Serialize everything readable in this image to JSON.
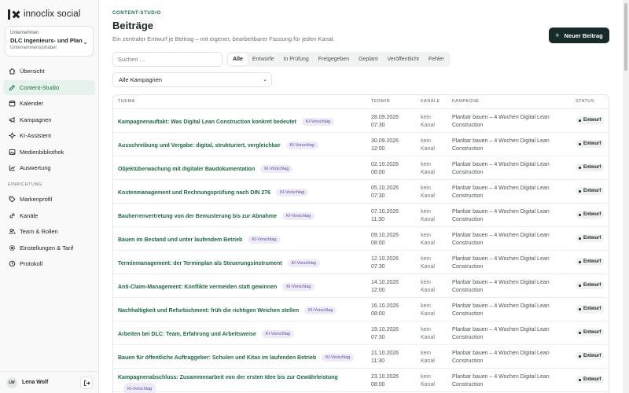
{
  "app": {
    "logo_text": "innoclix social"
  },
  "company": {
    "label": "Unternehmen",
    "name": "DLC Ingenieurs- und Planu",
    "role": "Unternehmensinhaber"
  },
  "nav": {
    "main": [
      {
        "label": "Übersicht",
        "icon": "home-icon"
      },
      {
        "label": "Content-Studio",
        "icon": "pen-icon",
        "active": true
      },
      {
        "label": "Kalender",
        "icon": "calendar-icon"
      },
      {
        "label": "Kampagnen",
        "icon": "megaphone-icon"
      },
      {
        "label": "KI-Assistent",
        "icon": "sparkle-icon"
      },
      {
        "label": "Medienbibliothek",
        "icon": "image-icon"
      },
      {
        "label": "Auswertung",
        "icon": "chart-icon"
      }
    ],
    "section_label": "EINRICHTUNG",
    "settings": [
      {
        "label": "Markenprofil",
        "icon": "tag-icon"
      },
      {
        "label": "Kanäle",
        "icon": "link-icon"
      },
      {
        "label": "Team & Rollen",
        "icon": "users-icon"
      },
      {
        "label": "Einstellungen & Tarif",
        "icon": "gear-icon"
      },
      {
        "label": "Protokoll",
        "icon": "clock-icon"
      }
    ]
  },
  "user": {
    "initials": "LW",
    "name": "Lena Wolf"
  },
  "header": {
    "eyebrow": "CONTENT-STUDIO",
    "title": "Beiträge",
    "subtitle": "Ein zentraler Entwurf je Beitrag – mit eigener, bearbeitbarer Fassung für jeden Kanal.",
    "new_button": "Neuer Beitrag"
  },
  "filters": {
    "search_placeholder": "Suchen …",
    "tabs": [
      "Alle",
      "Entwürfe",
      "In Prüfung",
      "Freigegeben",
      "Geplant",
      "Veröffentlicht",
      "Fehler"
    ],
    "active_tab": "Alle",
    "campaign_select": "Alle Kampagnen"
  },
  "table": {
    "headers": {
      "topic": "THEMA",
      "term": "TERMIN",
      "channel": "KANÄLE",
      "campaign": "KAMPAGNE",
      "status": "STATUS"
    },
    "ki_badge": "KI-Vorschlag",
    "rows": [
      {
        "topic": "Kampagnenauftakt: Was Digital Lean Construction konkret bedeutet",
        "date": "28.09.2026",
        "time": "07:30",
        "channel1": "kein",
        "channel2": "Kanal",
        "camp1": "Planbar bauen – 4 Wochen Digital Lean",
        "camp2": "Construction",
        "status": "Entwurf"
      },
      {
        "topic": "Ausschreibung und Vergabe: digital, strukturiert, vergleichbar",
        "date": "30.09.2026",
        "time": "12:00",
        "channel1": "kein",
        "channel2": "Kanal",
        "camp1": "Planbar bauen – 4 Wochen Digital Lean",
        "camp2": "Construction",
        "status": "Entwurf"
      },
      {
        "topic": "Objektüberwachung mit digitaler Baudokumentation",
        "date": "02.10.2026",
        "time": "08:00",
        "channel1": "kein",
        "channel2": "Kanal",
        "camp1": "Planbar bauen – 4 Wochen Digital Lean",
        "camp2": "Construction",
        "status": "Entwurf"
      },
      {
        "topic": "Kostenmanagement und Rechnungsprüfung nach DIN 276",
        "date": "05.10.2026",
        "time": "07:30",
        "channel1": "kein",
        "channel2": "Kanal",
        "camp1": "Planbar bauen – 4 Wochen Digital Lean",
        "camp2": "Construction",
        "status": "Entwurf"
      },
      {
        "topic": "Bauherrenvertretung von der Bemusterung bis zur Abnahme",
        "date": "07.10.2026",
        "time": "11:30",
        "channel1": "kein",
        "channel2": "Kanal",
        "camp1": "Planbar bauen – 4 Wochen Digital Lean",
        "camp2": "Construction",
        "status": "Entwurf"
      },
      {
        "topic": "Bauen im Bestand und unter laufendem Betrieb",
        "date": "09.10.2026",
        "time": "08:00",
        "channel1": "kein",
        "channel2": "Kanal",
        "camp1": "Planbar bauen – 4 Wochen Digital Lean",
        "camp2": "Construction",
        "status": "Entwurf"
      },
      {
        "topic": "Terminmanagement: der Terminplan als Steuerungsinstrument",
        "date": "12.10.2026",
        "time": "07:30",
        "channel1": "kein",
        "channel2": "Kanal",
        "camp1": "Planbar bauen – 4 Wochen Digital Lean",
        "camp2": "Construction",
        "status": "Entwurf"
      },
      {
        "topic": "Anti-Claim-Management: Konflikte vermeiden statt gewinnen",
        "date": "14.10.2026",
        "time": "12:00",
        "channel1": "kein",
        "channel2": "Kanal",
        "camp1": "Planbar bauen – 4 Wochen Digital Lean",
        "camp2": "Construction",
        "status": "Entwurf"
      },
      {
        "topic": "Nachhaltigkeit und Refurbishment: früh die richtigen Weichen stellen",
        "date": "16.10.2026",
        "time": "08:00",
        "channel1": "kein",
        "channel2": "Kanal",
        "camp1": "Planbar bauen – 4 Wochen Digital Lean",
        "camp2": "Construction",
        "status": "Entwurf"
      },
      {
        "topic": "Arbeiten bei DLC: Team, Erfahrung und Arbeitsweise",
        "date": "19.10.2026",
        "time": "07:30",
        "channel1": "kein",
        "channel2": "Kanal",
        "camp1": "Planbar bauen – 4 Wochen Digital Lean",
        "camp2": "Construction",
        "status": "Entwurf"
      },
      {
        "topic": "Bauen für öffentliche Auftraggeber: Schulen und Kitas im laufenden Betrieb",
        "date": "21.10.2026",
        "time": "11:30",
        "channel1": "kein",
        "channel2": "Kanal",
        "camp1": "Planbar bauen – 4 Wochen Digital Lean",
        "camp2": "Construction",
        "status": "Entwurf"
      },
      {
        "topic": "Kampagnenabschluss: Zusammenarbeit von der ersten Idee bis zur Gewährleistung",
        "date": "23.10.2026",
        "time": "08:00",
        "channel1": "kein",
        "channel2": "Kanal",
        "camp1": "Planbar bauen – 4 Wochen Digital Lean",
        "camp2": "Construction",
        "status": "Entwurf",
        "wrap": true
      }
    ]
  }
}
